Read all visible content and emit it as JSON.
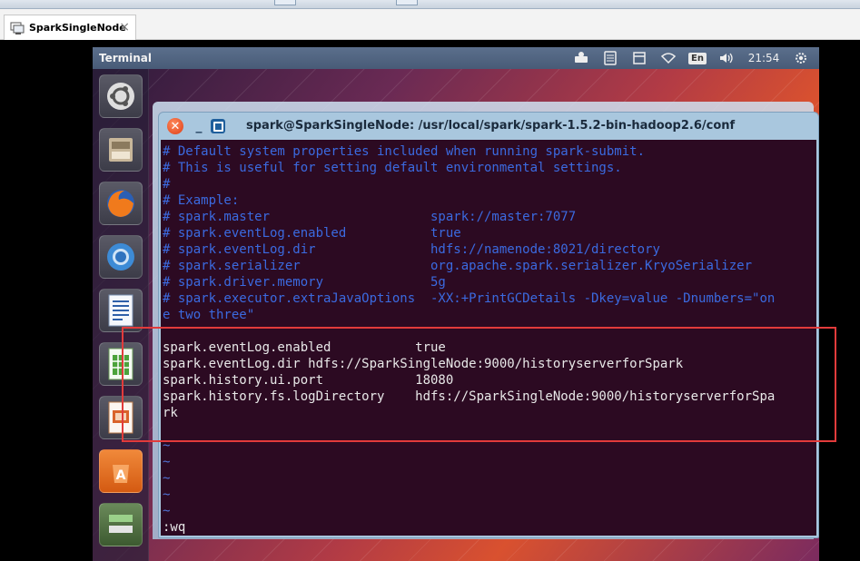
{
  "host": {
    "tab_label": "SparkSingleNode",
    "tab_close": "×"
  },
  "panel": {
    "app_title": "Terminal",
    "lang": "En",
    "clock": "21:54",
    "icons": [
      "network-icon",
      "keyboard-icon",
      "calendar-icon",
      "wifi-icon",
      "language-icon",
      "volume-icon",
      "clock",
      "gear-icon"
    ]
  },
  "launcher": {
    "items": [
      "ubuntu-dash-icon",
      "files-icon",
      "firefox-icon",
      "chromium-icon",
      "writer-icon",
      "calc-icon",
      "impress-icon",
      "software-center-icon",
      "workspace-icon",
      "trash-icon"
    ]
  },
  "terminal": {
    "title": "spark@SparkSingleNode: /usr/local/spark/spark-1.5.2-bin-hadoop2.6/conf",
    "comment_lines": [
      "# Default system properties included when running spark-submit.",
      "# This is useful for setting default environmental settings.",
      "#",
      "# Example:",
      "# spark.master                     spark://master:7077",
      "# spark.eventLog.enabled           true",
      "# spark.eventLog.dir               hdfs://namenode:8021/directory",
      "# spark.serializer                 org.apache.spark.serializer.KryoSerializer",
      "# spark.driver.memory              5g",
      "# spark.executor.extraJavaOptions  -XX:+PrintGCDetails -Dkey=value -Dnumbers=\"on",
      "e two three\""
    ],
    "config_lines": [
      "spark.eventLog.enabled           true",
      "spark.eventLog.dir hdfs://SparkSingleNode:9000/historyserverforSpark",
      "spark.history.ui.port            18080",
      "spark.history.fs.logDirectory    hdfs://SparkSingleNode:9000/historyserverforSpa",
      "rk"
    ],
    "tilde": "~",
    "command": ":wq"
  },
  "colors": {
    "terminal_bg": "#2c0a22",
    "comment": "#3b6ae0",
    "text": "#e8e8e8",
    "highlight": "#e23b3b"
  }
}
